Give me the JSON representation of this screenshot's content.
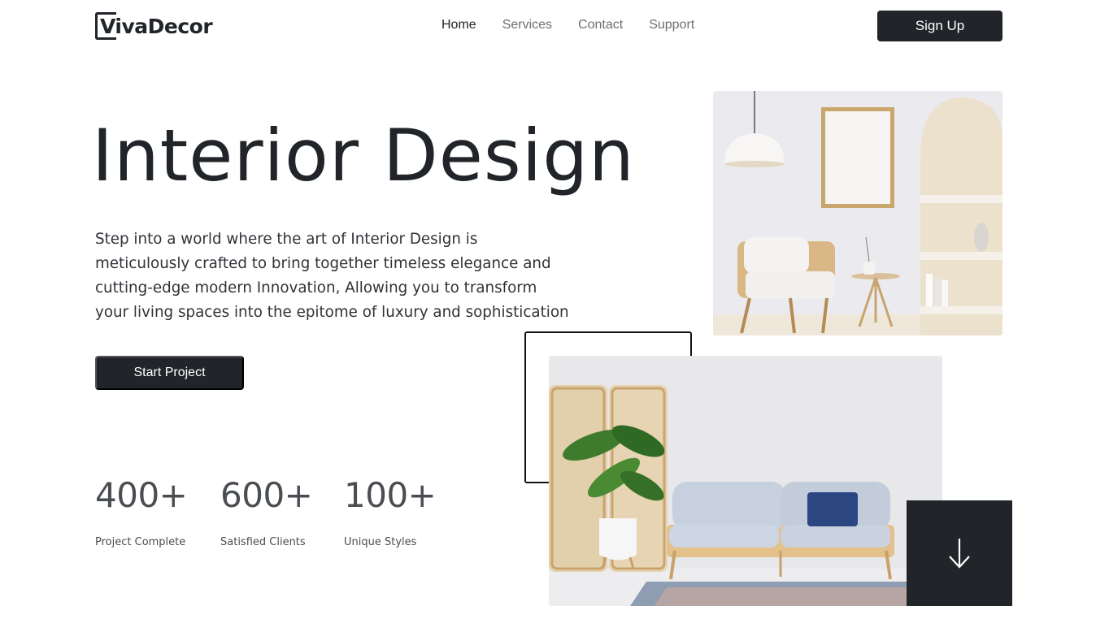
{
  "brand": {
    "name": "VivaDecor"
  },
  "nav": {
    "items": [
      {
        "label": "Home",
        "active": true
      },
      {
        "label": "Services",
        "active": false
      },
      {
        "label": "Contact",
        "active": false
      },
      {
        "label": "Support",
        "active": false
      }
    ]
  },
  "header": {
    "signup_label": "Sign Up"
  },
  "hero": {
    "title": "Interior Design",
    "description": "Step into a world where the art of Interior Design is meticulously crafted to bring together timeless elegance and cutting-edge modern Innovation, Allowing you to transform your living spaces into the epitome of luxury and sophistication",
    "cta_label": "Start Project"
  },
  "stats": [
    {
      "value": "400+",
      "label": "Project Complete"
    },
    {
      "value": "600+",
      "label": "Satisfied Clients"
    },
    {
      "value": "100+",
      "label": "Unique Styles"
    }
  ],
  "icons": {
    "scroll": "arrow-down-icon"
  },
  "colors": {
    "primary": "#212529",
    "muted": "#6c6f73"
  }
}
